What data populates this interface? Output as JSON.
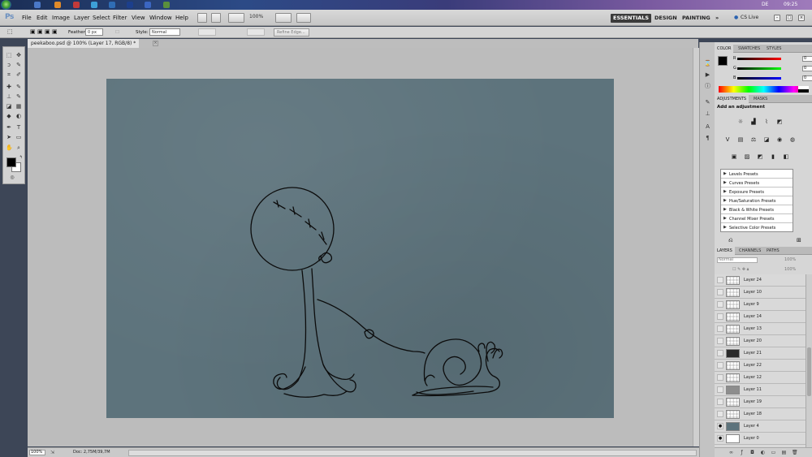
{
  "menubar": {
    "logo": "Ps",
    "menus": [
      "File",
      "Edit",
      "Image",
      "Layer",
      "Select",
      "Filter",
      "View",
      "Window",
      "Help"
    ],
    "zoom": "100%",
    "workspaces": [
      "ESSENTIALS",
      "DESIGN",
      "PAINTING"
    ],
    "more": "»",
    "cs_live": "CS Live"
  },
  "taskbar": {
    "lang": "DE",
    "clock": "09:25"
  },
  "options": {
    "feather_label": "Feather:",
    "feather_value": "0 px",
    "style_label": "Style:",
    "style_value": "Normal",
    "refine_edge": "Refine Edge..."
  },
  "document": {
    "tab_title": "peekaboo.psd @ 100% (Layer 17, RGB/8) *",
    "zoom": "100%",
    "doc_size": "Doc: 2,75M/39,7M"
  },
  "color_panel": {
    "tabs": [
      "COLOR",
      "SWATCHES",
      "STYLES"
    ],
    "r": 0,
    "g": 0,
    "b": 0,
    "r_label": "R",
    "g_label": "G",
    "b_label": "B"
  },
  "adjustments_panel": {
    "tabs": [
      "ADJUSTMENTS",
      "MASKS"
    ],
    "title": "Add an adjustment",
    "presets": [
      "Levels Presets",
      "Curves Presets",
      "Exposure Presets",
      "Hue/Saturation Presets",
      "Black & White Presets",
      "Channel Mixer Presets",
      "Selective Color Presets"
    ]
  },
  "layers_panel": {
    "tabs": [
      "LAYERS",
      "CHANNELS",
      "PATHS"
    ],
    "blend_mode": "Normal",
    "opacity": "100%",
    "fill": "100%",
    "layers": [
      {
        "name": "Layer 24",
        "visible": false,
        "thumb": "transparent"
      },
      {
        "name": "Layer 10",
        "visible": false,
        "thumb": "transparent"
      },
      {
        "name": "Layer 9",
        "visible": false,
        "thumb": "transparent"
      },
      {
        "name": "Layer 14",
        "visible": false,
        "thumb": "transparent"
      },
      {
        "name": "Layer 13",
        "visible": false,
        "thumb": "transparent"
      },
      {
        "name": "Layer 20",
        "visible": false,
        "thumb": "transparent"
      },
      {
        "name": "Layer 21",
        "visible": false,
        "thumb": "dark"
      },
      {
        "name": "Layer 22",
        "visible": false,
        "thumb": "transparent"
      },
      {
        "name": "Layer 12",
        "visible": false,
        "thumb": "transparent"
      },
      {
        "name": "Layer 11",
        "visible": false,
        "thumb": "grey"
      },
      {
        "name": "Layer 19",
        "visible": false,
        "thumb": "transparent"
      },
      {
        "name": "Layer 18",
        "visible": false,
        "thumb": "transparent"
      },
      {
        "name": "Layer 4",
        "visible": true,
        "thumb": "slate"
      },
      {
        "name": "Layer 0",
        "visible": true,
        "thumb": "white"
      }
    ]
  },
  "colors": {
    "canvas": "#5d737c",
    "workspace": "#bcbcbc"
  }
}
